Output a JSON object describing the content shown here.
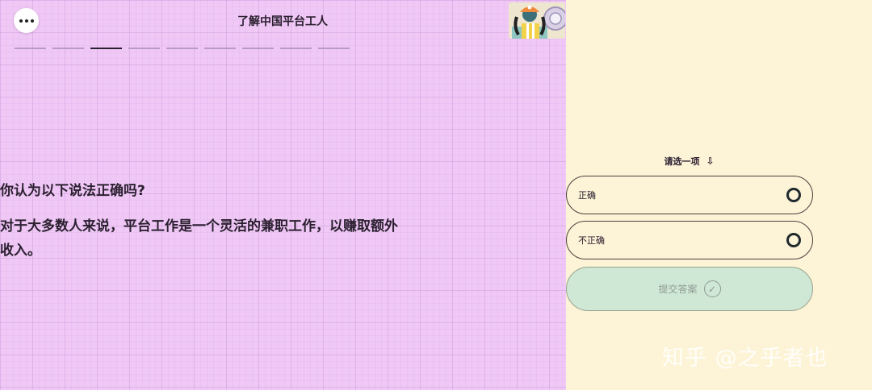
{
  "header": {
    "title": "了解中国平台工人",
    "progress": {
      "total": 9,
      "current": 3
    }
  },
  "question": {
    "heading": "你认为以下说法正确吗?",
    "statement": "对于大多数人来说，平台工作是一个灵活的兼职工作，以赚取额外收入。"
  },
  "answers": {
    "hint": "请选一项",
    "options": [
      {
        "label": "正确"
      },
      {
        "label": "不正确"
      }
    ],
    "submit_label": "提交答案"
  },
  "watermark": "知乎 @之乎者也",
  "icons": {
    "menu": "more-dots-icon",
    "hint_arrow": "down-arrow-icon",
    "submit": "check-circle-icon",
    "illustration": "worker-illustration"
  },
  "colors": {
    "left_bg": "#f0c8f6",
    "right_bg": "#fdf3d6",
    "submit_bg": "#cfe8d6",
    "text": "#2b2030"
  }
}
